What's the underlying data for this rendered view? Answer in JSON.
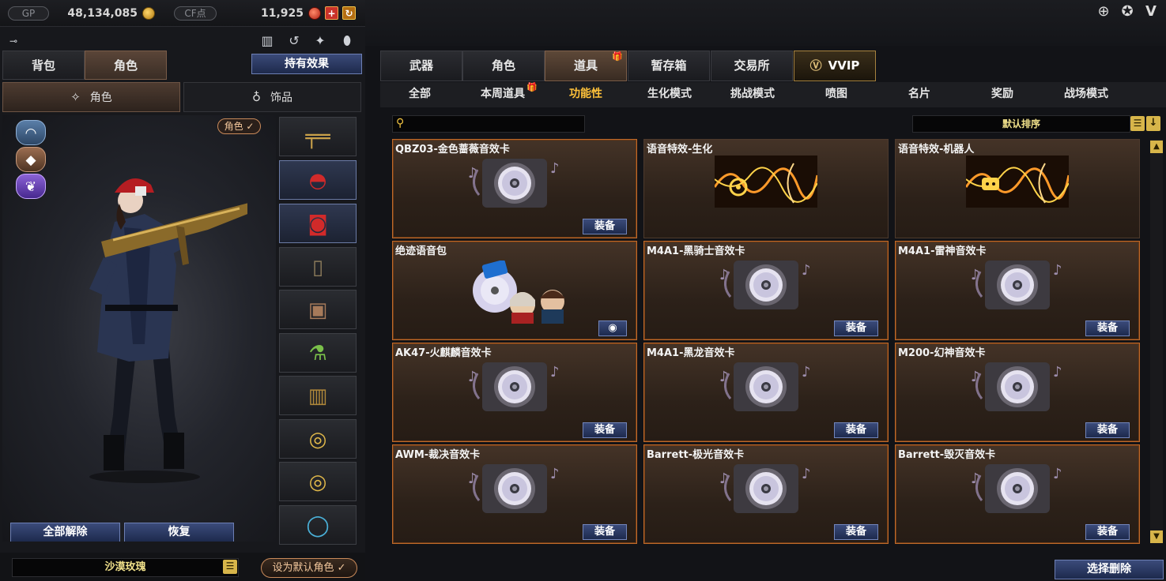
{
  "currency": {
    "gp_label": "GP",
    "gp_value": "48,134,085",
    "cf_label": "CF点",
    "cf_value": "11,925"
  },
  "left_tabs": [
    {
      "label": "背包",
      "active": false
    },
    {
      "label": "角色",
      "active": true
    }
  ],
  "hold_effect_label": "持有效果",
  "sub_tabs": [
    {
      "label": "角色",
      "icon": "character-icon",
      "active": true
    },
    {
      "label": "饰品",
      "icon": "accessory-icon",
      "active": false
    }
  ],
  "role_badge": "角色 ✓",
  "slots": [
    {
      "icon": "rifle-icon"
    },
    {
      "icon": "red-cap-icon"
    },
    {
      "icon": "red-goggles-icon"
    },
    {
      "icon": "radio-icon"
    },
    {
      "icon": "backpack-icon"
    },
    {
      "icon": "bamboo-canister-icon"
    },
    {
      "icon": "ammo-pouch-icon"
    },
    {
      "icon": "gold-ring-icon"
    },
    {
      "icon": "gold-ring-icon"
    },
    {
      "icon": "blue-ring-icon"
    }
  ],
  "unequip_all_label": "全部解除",
  "restore_label": "恢复",
  "character_name": "沙漠玫瑰",
  "set_default_label": "设为默认角色 ✓",
  "main_tabs": [
    {
      "label": "武器",
      "active": false,
      "gift": false
    },
    {
      "label": "角色",
      "active": false,
      "gift": false
    },
    {
      "label": "道具",
      "active": true,
      "gift": true
    },
    {
      "label": "暂存箱",
      "active": false,
      "gift": false
    },
    {
      "label": "交易所",
      "active": false,
      "gift": false
    },
    {
      "label": "VVIP",
      "active": false,
      "gift": false
    }
  ],
  "filter_tabs": [
    {
      "label": "全部",
      "active": false
    },
    {
      "label": "本周道具",
      "active": false,
      "gift": true
    },
    {
      "label": "功能性",
      "active": true
    },
    {
      "label": "生化模式",
      "active": false
    },
    {
      "label": "挑战模式",
      "active": false
    },
    {
      "label": "喷图",
      "active": false
    },
    {
      "label": "名片",
      "active": false
    },
    {
      "label": "奖励",
      "active": false
    },
    {
      "label": "战场模式",
      "active": false
    }
  ],
  "search": {
    "placeholder": ""
  },
  "sort_label": "默认排序",
  "equip_label": "装备",
  "items": [
    {
      "title": "QBZ03-金色蔷薇音效卡",
      "art": "music-disc-icon",
      "button": "equip",
      "highlight": true
    },
    {
      "title": "语音特效-生化",
      "art": "voice-effect-icon",
      "button": "none",
      "highlight": false
    },
    {
      "title": "语音特效-机器人",
      "art": "voice-robot-icon",
      "button": "none",
      "highlight": false
    },
    {
      "title": "绝迹语音包",
      "art": "voice-pack-icon",
      "button": "disc",
      "highlight": true
    },
    {
      "title": "M4A1-黑骑士音效卡",
      "art": "music-disc-icon",
      "button": "equip",
      "highlight": true
    },
    {
      "title": "M4A1-雷神音效卡",
      "art": "music-disc-icon",
      "button": "equip",
      "highlight": true
    },
    {
      "title": "AK47-火麒麟音效卡",
      "art": "music-disc-icon",
      "button": "equip",
      "highlight": true
    },
    {
      "title": "M4A1-黑龙音效卡",
      "art": "music-disc-icon",
      "button": "equip",
      "highlight": true
    },
    {
      "title": "M200-幻神音效卡",
      "art": "music-disc-icon",
      "button": "equip",
      "highlight": true
    },
    {
      "title": "AWM-裁决音效卡",
      "art": "music-disc-icon",
      "button": "equip",
      "highlight": true
    },
    {
      "title": "Barrett-极光音效卡",
      "art": "music-disc-icon",
      "button": "equip",
      "highlight": true
    },
    {
      "title": "Barrett-毁灭音效卡",
      "art": "music-disc-icon",
      "button": "equip",
      "highlight": true
    }
  ],
  "select_delete_label": "选择删除",
  "colors": {
    "accent_gold": "#ffc23a",
    "button_blue": "#2c3b66",
    "card_border_hl": "#c06a2a"
  }
}
